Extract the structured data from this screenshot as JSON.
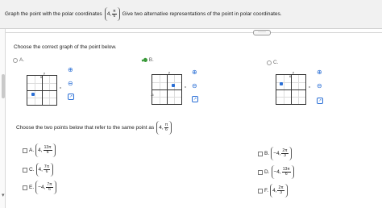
{
  "prompt": {
    "text_before": "Graph the point with the polar coordinates",
    "coord_r": "4,",
    "coord_num": "π",
    "coord_den": "6",
    "text_after": "Give two alternative representations of the point in polar coordinates."
  },
  "more_button": "·····",
  "graph_question": "Choose the correct graph of the point below.",
  "graph_options": [
    {
      "letter": "A.",
      "selected": false
    },
    {
      "letter": "B.",
      "selected": true
    },
    {
      "letter": "C.",
      "selected": false
    }
  ],
  "graph_ticks": {
    "y_top": "6",
    "y_bottom": "-6",
    "x_left": "-6",
    "x_right": "6",
    "x": "x",
    "y": "y"
  },
  "points_question": {
    "text": "Choose the two points below that refer to the same point as",
    "coord_r": "4,",
    "coord_num": "π",
    "coord_den": "6"
  },
  "point_options": [
    {
      "letter": "A.",
      "r": "4,",
      "num": "13π",
      "den": "6"
    },
    {
      "letter": "B.",
      "r": "−4,",
      "num": "2π",
      "den": "3"
    },
    {
      "letter": "C.",
      "r": "4,",
      "num": "7π",
      "den": "6"
    },
    {
      "letter": "D.",
      "r": "−4,",
      "num": "13π",
      "den": "6"
    },
    {
      "letter": "E.",
      "r": "−4,",
      "num": "7π",
      "den": "6"
    },
    {
      "letter": "F.",
      "r": "4,",
      "num": "2π",
      "den": "3"
    }
  ],
  "colors": {
    "accent": "#2a6fd6",
    "check": "#3a9a3a",
    "header_bg": "#f1f1f1"
  },
  "icons": {
    "zoom_in": "zoom-in-icon",
    "zoom_out": "zoom-out-icon",
    "external": "external-link-icon",
    "check": "check-icon"
  }
}
